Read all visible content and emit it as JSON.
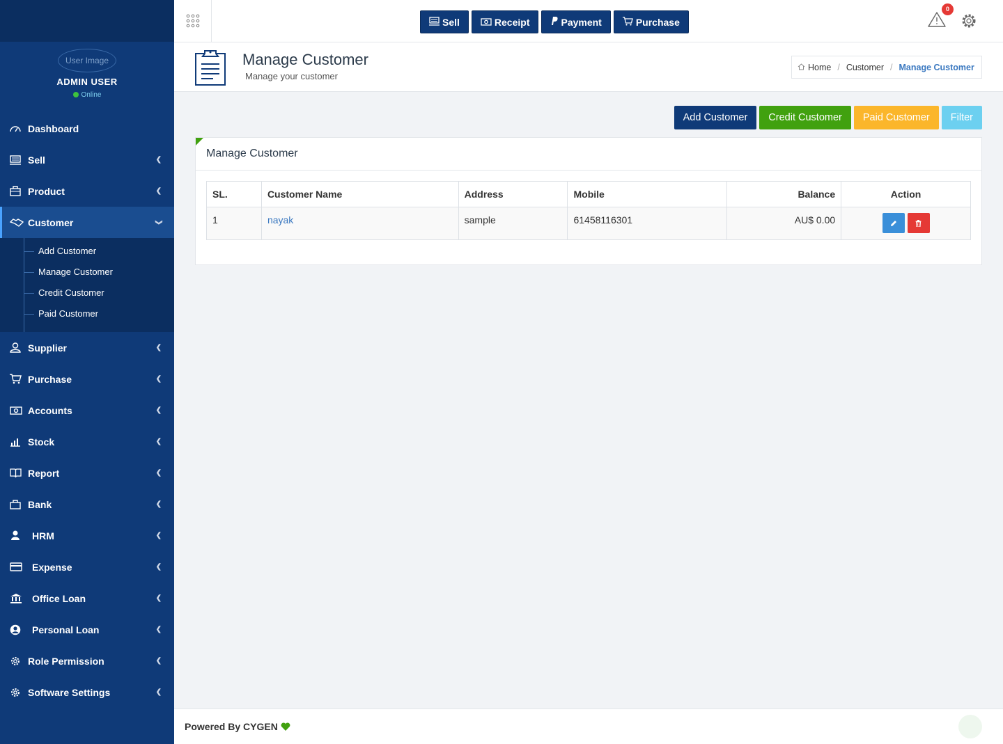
{
  "sidebar": {
    "avatar_alt": "User Image",
    "user_name": "ADMIN USER",
    "user_status": "Online",
    "items": [
      {
        "label": "Dashboard",
        "icon": "dashboard-icon"
      },
      {
        "label": "Sell",
        "icon": "sell-icon"
      },
      {
        "label": "Product",
        "icon": "product-icon"
      },
      {
        "label": "Customer",
        "icon": "handshake-icon"
      },
      {
        "label": "Supplier",
        "icon": "user-icon"
      },
      {
        "label": "Purchase",
        "icon": "cart-icon"
      },
      {
        "label": "Accounts",
        "icon": "money-icon"
      },
      {
        "label": "Stock",
        "icon": "bar-chart-icon"
      },
      {
        "label": "Report",
        "icon": "book-icon"
      },
      {
        "label": "Bank",
        "icon": "briefcase-icon"
      },
      {
        "label": "HRM",
        "icon": "person-icon"
      },
      {
        "label": "Expense",
        "icon": "credit-card-icon"
      },
      {
        "label": "Office Loan",
        "icon": "bank-icon"
      },
      {
        "label": "Personal Loan",
        "icon": "user-circle-icon"
      },
      {
        "label": "Role Permission",
        "icon": "gear-icon"
      },
      {
        "label": "Software Settings",
        "icon": "settings-icon"
      }
    ],
    "customer_submenu": [
      "Add Customer",
      "Manage Customer",
      "Credit Customer",
      "Paid Customer"
    ]
  },
  "topbar": {
    "quick_buttons": [
      "Sell",
      "Receipt",
      "Payment",
      "Purchase"
    ],
    "alert_count": "0"
  },
  "page_header": {
    "title": "Manage Customer",
    "subtitle": "Manage your customer",
    "breadcrumb": [
      "Home",
      "Customer",
      "Manage Customer"
    ]
  },
  "actions": [
    "Add Customer",
    "Credit Customer",
    "Paid Customer",
    "Filter"
  ],
  "panel": {
    "title": "Manage Customer",
    "columns": [
      "SL.",
      "Customer Name",
      "Address",
      "Mobile",
      "Balance",
      "Action"
    ],
    "rows": [
      {
        "sl": "1",
        "name": "nayak",
        "address": "sample",
        "mobile": "61458116301",
        "balance": "AU$ 0.00"
      }
    ]
  },
  "footer": {
    "text": "Powered By CYGEN"
  },
  "colors": {
    "navy": "#0f3a78",
    "green": "#41a10f",
    "orange": "#fbb62b",
    "cyan": "#6cd0f0",
    "red": "#e53935",
    "link": "#3a78c0"
  }
}
